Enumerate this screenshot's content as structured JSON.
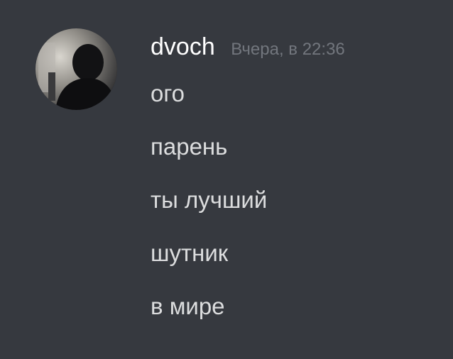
{
  "message": {
    "author": "dvoch",
    "timestamp": "Вчера, в 22:36",
    "avatar_icon": "user-avatar",
    "lines": [
      "ого",
      "парень",
      "ты лучший",
      "шутник",
      "в мире"
    ]
  },
  "colors": {
    "background": "#36393f",
    "username": "#ffffff",
    "timestamp": "#72767d",
    "text": "#dcddde"
  }
}
